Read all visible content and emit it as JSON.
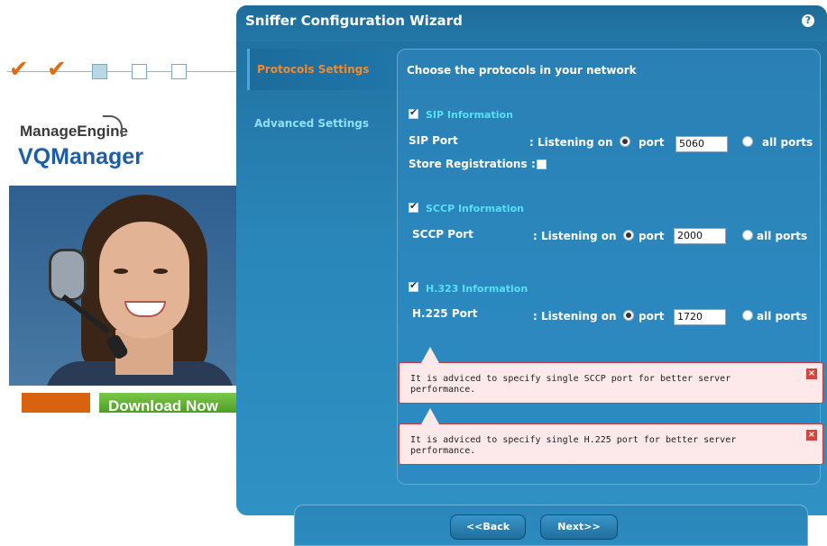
{
  "background": {
    "brand_top": "ManageEngine",
    "brand_main": "VQManager",
    "cta_label": "Download Now"
  },
  "wizard": {
    "title": "Sniffer Configuration Wizard",
    "help_icon": "?",
    "sidebar": [
      {
        "label": "Protocols Settings",
        "active": true
      },
      {
        "label": "Advanced Settings",
        "active": false
      }
    ],
    "heading": "Choose the protocols in your network",
    "sections": {
      "sip": {
        "title": "SIP Information",
        "port_label": "SIP Port",
        "listening_label": ": Listening on",
        "port_option": "port",
        "port_value": "5060",
        "all_ports_option": "all ports",
        "store_label": "Store Registrations",
        "store_colon": ":"
      },
      "sccp": {
        "title": "SCCP Information",
        "port_label": "SCCP Port",
        "listening_label": ": Listening on",
        "port_option": "port",
        "port_value": "2000",
        "all_ports_option": "all ports"
      },
      "h323": {
        "title": "H.323 Information",
        "port_label": "H.225 Port",
        "listening_label": ": Listening on",
        "port_option": "port",
        "port_value": "1720",
        "all_ports_option": "all ports"
      }
    },
    "tooltips": [
      {
        "text": "It is adviced to specify single SCCP port for better server performance.",
        "close": "×"
      },
      {
        "text": "It is adviced to specify single H.225 port for better server performance.",
        "close": "×"
      }
    ],
    "buttons": {
      "back": "<<Back",
      "next": "Next>>"
    }
  },
  "colors": {
    "wizard_bg": "#2a86b8",
    "accent_orange": "#f28a2e",
    "section_cyan": "#54e1f7",
    "tooltip_bg": "#fde9ea",
    "tooltip_border": "#c93b3b"
  }
}
